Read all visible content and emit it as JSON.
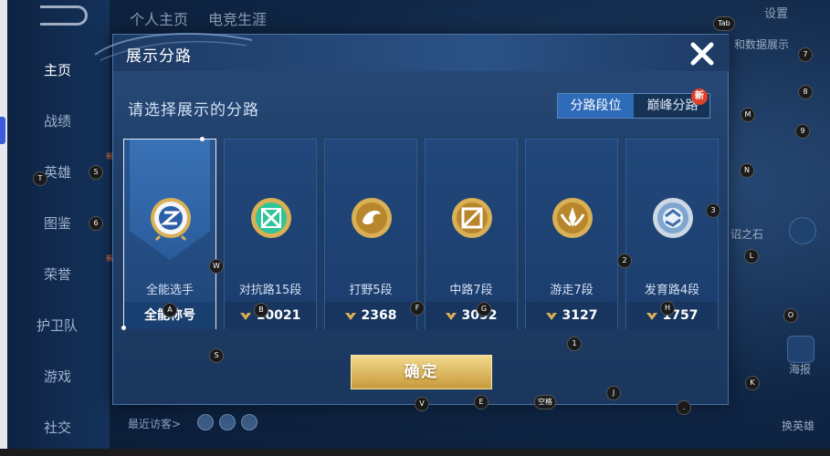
{
  "background": {
    "sidebar": [
      {
        "label": "主页",
        "active": true
      },
      {
        "label": "战绩"
      },
      {
        "label": "英雄",
        "sub": "新"
      },
      {
        "label": "图鉴"
      },
      {
        "label": "荣誉",
        "sub": "新"
      },
      {
        "label": "护卫队"
      },
      {
        "label": "游戏"
      },
      {
        "label": "社交"
      }
    ],
    "top_tabs": [
      "个人主页",
      "电竞生涯"
    ],
    "settings_label": "设置",
    "right_labels": [
      "和数据展示",
      "诏之石",
      "海报",
      "换英雄"
    ],
    "recent_visitors": "最近访客>"
  },
  "modal": {
    "title": "展示分路",
    "subtitle": "请选择展示的分路",
    "segments": [
      {
        "label": "分路段位",
        "active": true
      },
      {
        "label": "巅峰分路",
        "active": false
      }
    ],
    "new_badge": "新",
    "cards": [
      {
        "name": "全能选手",
        "score": "全能称号",
        "selected": true,
        "emblem": "all-round-icon"
      },
      {
        "name": "对抗路15段",
        "score": "10021",
        "emblem": "clash-lane-icon"
      },
      {
        "name": "打野5段",
        "score": "2368",
        "emblem": "jungle-icon"
      },
      {
        "name": "中路7段",
        "score": "3092",
        "emblem": "mid-lane-icon"
      },
      {
        "name": "游走7段",
        "score": "3127",
        "emblem": "roam-icon"
      },
      {
        "name": "发育路4段",
        "score": "1757",
        "emblem": "farm-lane-icon"
      }
    ],
    "confirm_label": "确定"
  },
  "key_hints": [
    "Tab",
    "7",
    "8",
    "M",
    "9",
    "N",
    "3",
    "L",
    "2",
    "O",
    "K",
    "T",
    "5",
    "6",
    "W",
    "A",
    "B",
    "F",
    "G",
    "H",
    "S",
    "1",
    "V",
    "E",
    "空格",
    "J",
    "."
  ],
  "colors": {
    "accent": "#2e6bb8",
    "gold": "#d9b055",
    "green_emblem": "#2fc49a",
    "silver_emblem": "#cdd8e6"
  }
}
